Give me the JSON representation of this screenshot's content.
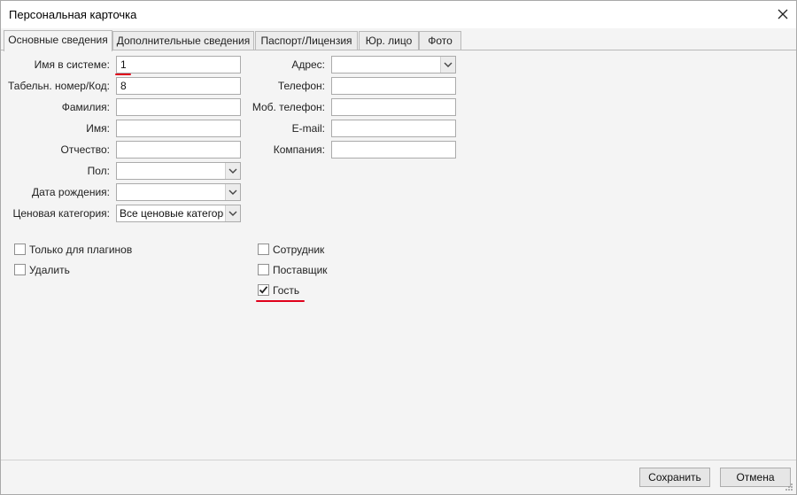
{
  "window": {
    "title": "Персональная карточка"
  },
  "tabs": [
    {
      "label": "Основные сведения",
      "active": true
    },
    {
      "label": "Дополнительные сведения",
      "active": false
    },
    {
      "label": "Паспорт/Лицензия",
      "active": false
    },
    {
      "label": "Юр. лицо",
      "active": false
    },
    {
      "label": "Фото",
      "active": false
    }
  ],
  "left_fields": {
    "login_label": "Имя в системе:",
    "login_value": "1",
    "tab_number_label": "Табельн. номер/Код:",
    "tab_number_value": "8",
    "last_name_label": "Фамилия:",
    "last_name_value": "",
    "first_name_label": "Имя:",
    "first_name_value": "",
    "middle_name_label": "Отчество:",
    "middle_name_value": "",
    "gender_label": "Пол:",
    "gender_value": "",
    "birth_date_label": "Дата рождения:",
    "birth_date_value": "",
    "price_category_label": "Ценовая категория:",
    "price_category_value": "Все ценовые категории"
  },
  "right_fields": {
    "address_label": "Адрес:",
    "address_value": "",
    "phone_label": "Телефон:",
    "phone_value": "",
    "mobile_label": "Моб. телефон:",
    "mobile_value": "",
    "email_label": "E-mail:",
    "email_value": "",
    "company_label": "Компания:",
    "company_value": ""
  },
  "checkboxes": {
    "plugins_only": {
      "label": "Только для плагинов",
      "checked": false
    },
    "delete": {
      "label": "Удалить",
      "checked": false
    },
    "employee": {
      "label": "Сотрудник",
      "checked": false
    },
    "supplier": {
      "label": "Поставщик",
      "checked": false
    },
    "guest": {
      "label": "Гость",
      "checked": true
    }
  },
  "footer": {
    "save_label": "Сохранить",
    "cancel_label": "Отмена"
  },
  "colors": {
    "annotation": "#e0001b",
    "window_bg": "#f4f4f4",
    "titlebar_bg": "#ffffff"
  },
  "icons": {
    "close": "close-icon",
    "dropdown": "chevron-down-icon",
    "check": "checkmark-icon",
    "resize": "resize-grip-icon"
  }
}
